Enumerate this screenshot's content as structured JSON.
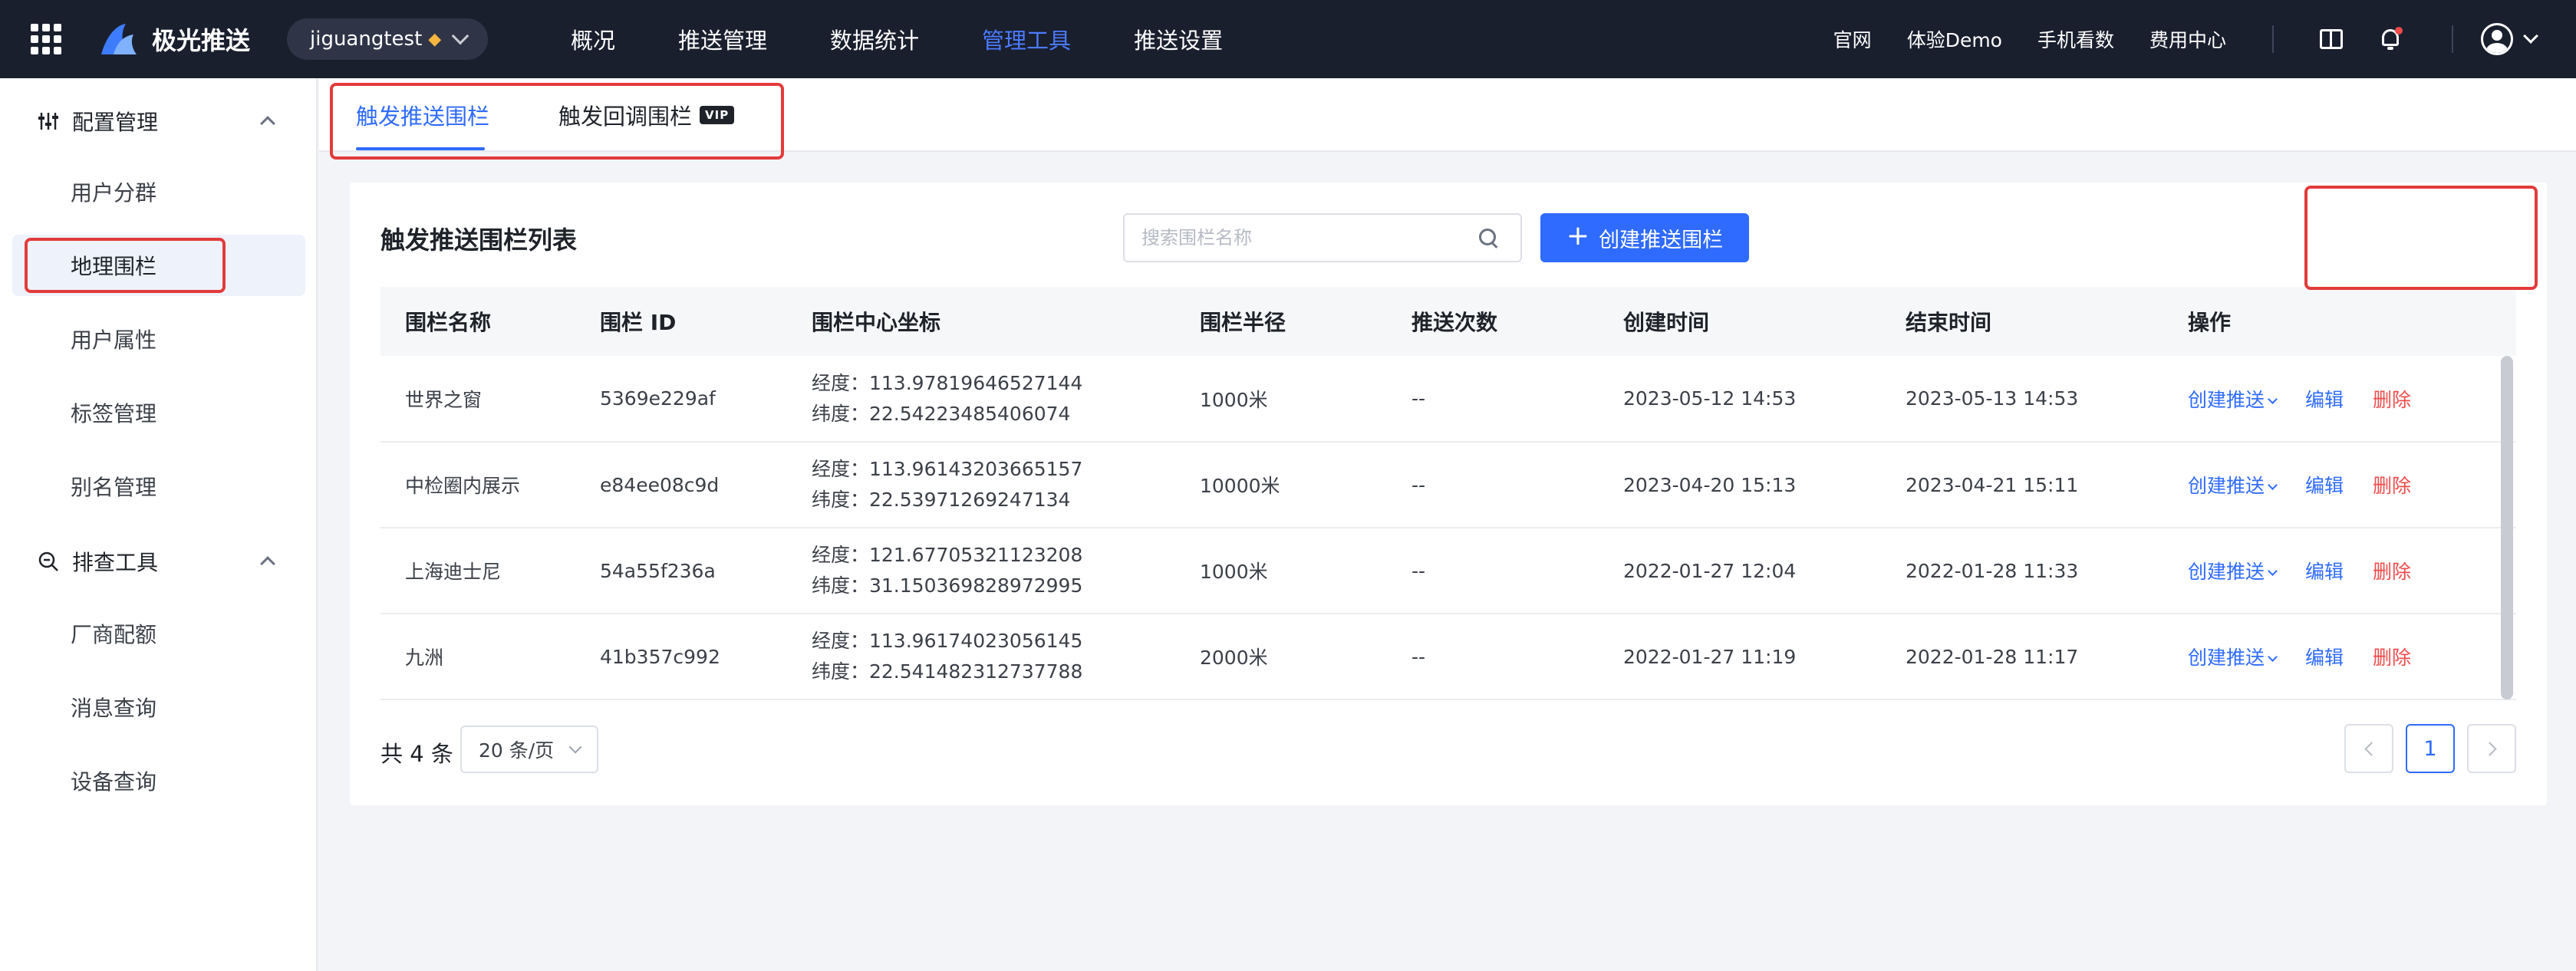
{
  "topbar": {
    "brand": "极光推送",
    "app_name": "jiguangtest",
    "nav": [
      "概况",
      "推送管理",
      "数据统计",
      "管理工具",
      "推送设置"
    ],
    "active_nav": "管理工具",
    "links": [
      "官网",
      "体验Demo",
      "手机看数",
      "费用中心"
    ]
  },
  "sidebar": {
    "groups": [
      {
        "label": "配置管理",
        "items": [
          "用户分群",
          "地理围栏",
          "用户属性",
          "标签管理",
          "别名管理"
        ]
      },
      {
        "label": "排查工具",
        "items": [
          "厂商配额",
          "消息查询",
          "设备查询"
        ]
      }
    ],
    "active_item": "地理围栏"
  },
  "tabs": [
    {
      "label": "触发推送围栏",
      "active": true
    },
    {
      "label": "触发回调围栏",
      "badge": "VIP",
      "active": false
    }
  ],
  "card": {
    "title": "触发推送围栏列表",
    "search_placeholder": "搜索围栏名称",
    "create_label": "创建推送围栏"
  },
  "table": {
    "columns": [
      "围栏名称",
      "围栏 ID",
      "围栏中心坐标",
      "围栏半径",
      "推送次数",
      "创建时间",
      "结束时间",
      "操作"
    ],
    "rows": [
      {
        "name": "世界之窗",
        "id": "5369e229af",
        "lng": "经度：113.97819646527144",
        "lat": "纬度：22.54223485406074",
        "radius": "1000米",
        "count": "--",
        "created": "2023-05-12 14:53",
        "ended": "2023-05-13 14:53"
      },
      {
        "name": "中检圈内展示",
        "id": "e84ee08c9d",
        "lng": "经度：113.96143203665157",
        "lat": "纬度：22.53971269247134",
        "radius": "10000米",
        "count": "--",
        "created": "2023-04-20 15:13",
        "ended": "2023-04-21 15:11"
      },
      {
        "name": "上海迪士尼",
        "id": "54a55f236a",
        "lng": "经度：121.67705321123208",
        "lat": "纬度：31.150369828972995",
        "radius": "1000米",
        "count": "--",
        "created": "2022-01-27 12:04",
        "ended": "2022-01-28 11:33"
      },
      {
        "name": "九洲",
        "id": "41b357c992",
        "lng": "经度：113.96174023056145",
        "lat": "纬度：22.541482312737788",
        "radius": "2000米",
        "count": "--",
        "created": "2022-01-27 11:19",
        "ended": "2022-01-28 11:17"
      }
    ],
    "ops": {
      "create": "创建推送",
      "edit": "编辑",
      "delete": "删除"
    }
  },
  "pagination": {
    "total": "共 4 条",
    "page_size": "20 条/页",
    "current": "1"
  },
  "colors": {
    "accent": "#2f6bff",
    "danger": "#f04b4b",
    "topbar": "#1a1f2e",
    "highlight": "#e23b3b"
  }
}
